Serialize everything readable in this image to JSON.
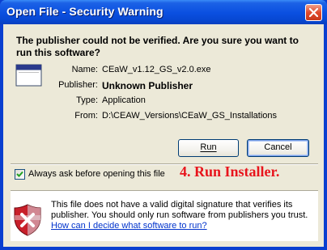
{
  "window": {
    "title": "Open File - Security Warning",
    "close_icon": "close-icon"
  },
  "dialog": {
    "headline": "The publisher could not be verified.  Are you sure you want to run this software?",
    "app_icon": "application-window-icon",
    "details": [
      {
        "label": "Name:",
        "value": "CEaW_v1.12_GS_v2.0.exe",
        "bold": false
      },
      {
        "label": "Publisher:",
        "value": "Unknown Publisher",
        "bold": true
      },
      {
        "label": "Type:",
        "value": "Application",
        "bold": false
      },
      {
        "label": "From:",
        "value": "D:\\CEAW_Versions\\CEaW_GS_Installations",
        "bold": false
      }
    ],
    "buttons": {
      "run_label": "Run",
      "cancel_label": "Cancel"
    },
    "checkbox": {
      "label": "Always ask before opening this file",
      "checked": true
    },
    "annotation": "4.  Run Installer.",
    "warning": {
      "icon": "shield-warning-icon",
      "text": "This file does not have a valid digital signature that verifies its publisher.  You should only run software from publishers you trust.",
      "link_text": "How can I decide what software to run?"
    }
  },
  "colors": {
    "titlebar": "#0a4fe0",
    "dialog_bg": "#ece9d8",
    "link": "#0033cc",
    "annotation": "#e8141c"
  }
}
